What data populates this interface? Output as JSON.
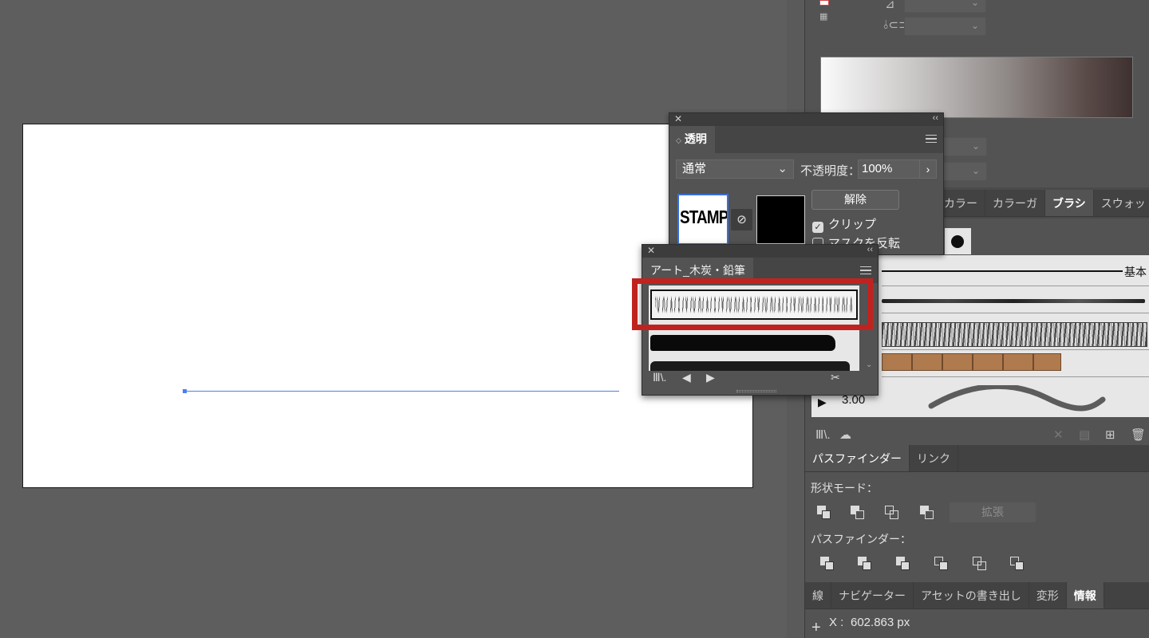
{
  "canvas": {
    "artboard": "artboard"
  },
  "transparency_panel": {
    "tab_label": "透明",
    "blend_mode": "通常",
    "opacity_label": "不透明度：",
    "opacity_value": "100%",
    "thumbnail_text": "STAMP",
    "release_button": "解除",
    "clip_label": "クリップ",
    "clip_checked": true,
    "invert_mask_label": "マスクを反転",
    "invert_mask_checked": false
  },
  "brush_library_panel": {
    "tab_label": "アート_木炭・鉛筆"
  },
  "dock": {
    "color_tabs": [
      "カラー",
      "カラーガ",
      "ブラシ",
      "スウォッ"
    ],
    "active_color_tab": "ブラシ",
    "brush_basic_label": "基本",
    "brush_weight": "3.00",
    "pathfinder_tabs": [
      "パスファインダー",
      "リンク"
    ],
    "shape_mode_label": "形状モード：",
    "expand_button": "拡張",
    "pathfinder_label": "パスファインダー：",
    "bottom_tabs": [
      "線",
      "ナビゲーター",
      "アセットの書き出し",
      "変形",
      "情報"
    ],
    "active_bottom_tab": "情報",
    "info_x_label": "X :",
    "info_x_value": "602.863 px"
  },
  "colors": {
    "highlight": "#c0231f",
    "selection": "#4a7ff0",
    "panel_bg": "#535353"
  },
  "icons": [
    "close-icon",
    "collapse-icon",
    "panel-menu-icon",
    "link-icon",
    "brush-library-icon",
    "arrow-left-icon",
    "arrow-right-icon",
    "remove-brush-icon",
    "delete-icon",
    "new-brush-icon",
    "pathfinder-shape-icon"
  ]
}
